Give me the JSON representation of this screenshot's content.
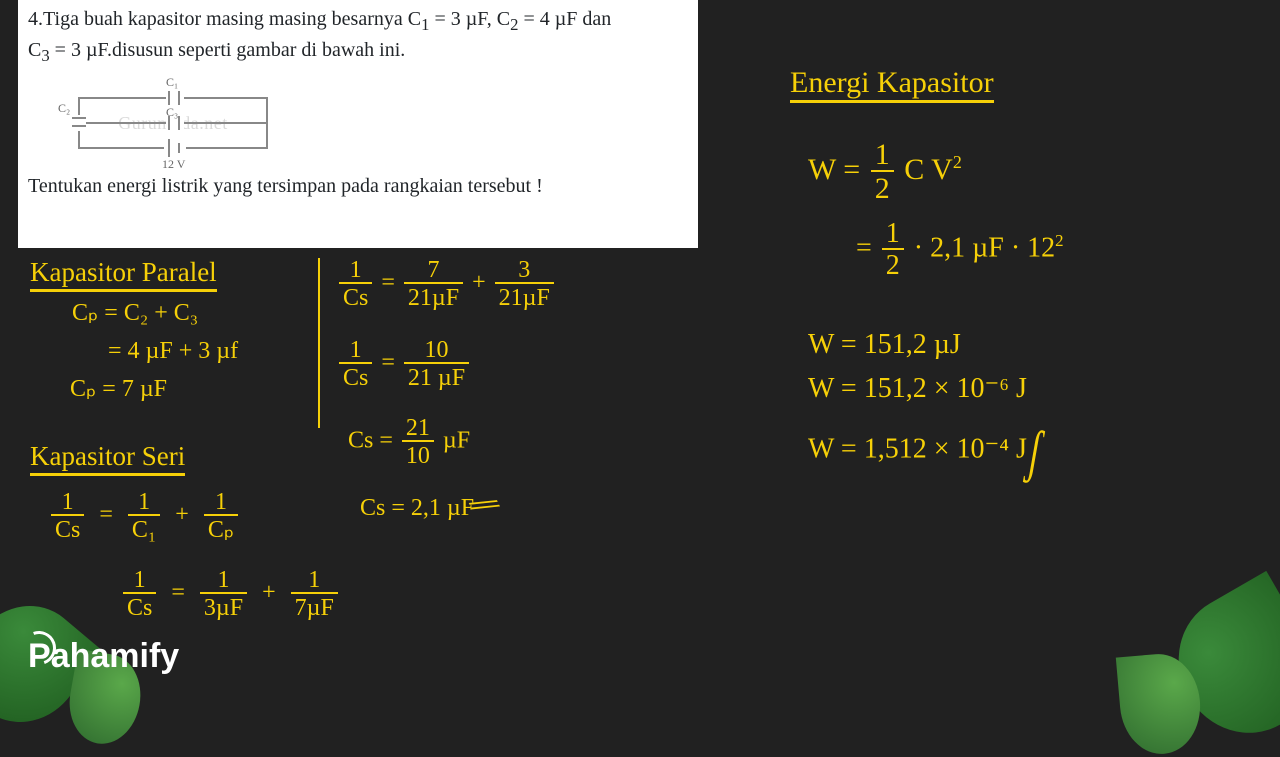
{
  "problem": {
    "line1_a": "4.Tiga buah kapasitor masing masing besarnya  C",
    "line1_b": " = 3 µF, C",
    "line1_c": " = 4 µF dan",
    "line2_a": "C",
    "line2_b": " = 3 µF.disusun seperti gambar di bawah ini.",
    "question": "Tentukan energi listrik yang tersimpan pada rangkaian tersebut !",
    "watermark": "Gurumuda.net",
    "circuit": {
      "c1": "C₁",
      "c2": "C₂",
      "c3": "C₃",
      "v": "12 V"
    }
  },
  "work": {
    "left": {
      "title_parallel": "Kapasitor Paralel",
      "cp_eq1": "Cₚ = C₂ + C₃",
      "cp_eq2": "= 4 µF + 3 µf",
      "cp_eq3": "Cₚ = 7 µF",
      "title_series": "Kapasitor Seri",
      "cs_sym_1": "1",
      "cs_sym_Cs": "Cs",
      "cs_sym_C1": "C₁",
      "cs_sym_Cp": "Cₚ",
      "cs_row2_b": "3µF",
      "cs_row2_c": "7µF"
    },
    "mid": {
      "m1_n1": "1",
      "m1_d1": "Cs",
      "m1_eq": "=",
      "m1_n2": "7",
      "m1_d2": "21µF",
      "m1_plus": "+",
      "m1_n3": "3",
      "m1_d3": "21µF",
      "m2_n1": "1",
      "m2_d1": "Cs",
      "m2_eq": "=",
      "m2_n2": "10",
      "m2_d2": "21 µF",
      "m3_a": "Cs =",
      "m3_n": "21",
      "m3_d": "10",
      "m3_u": "µF",
      "m4": "Cs = 2,1 µF"
    },
    "right": {
      "title_energy": "Energi Kapasitor",
      "w_formula_a": "W =",
      "half_n": "1",
      "half_d": "2",
      "w_formula_b": "C V",
      "w_sq": "2",
      "sub_a": "=",
      "sub_b": "· 2,1 µF · 12",
      "r1": "W = 151,2 µJ",
      "r2": "W = 151,2 × 10⁻⁶ J",
      "r3": "W = 1,512 × 10⁻⁴ J"
    }
  },
  "logo": {
    "text": "Pahamify"
  }
}
